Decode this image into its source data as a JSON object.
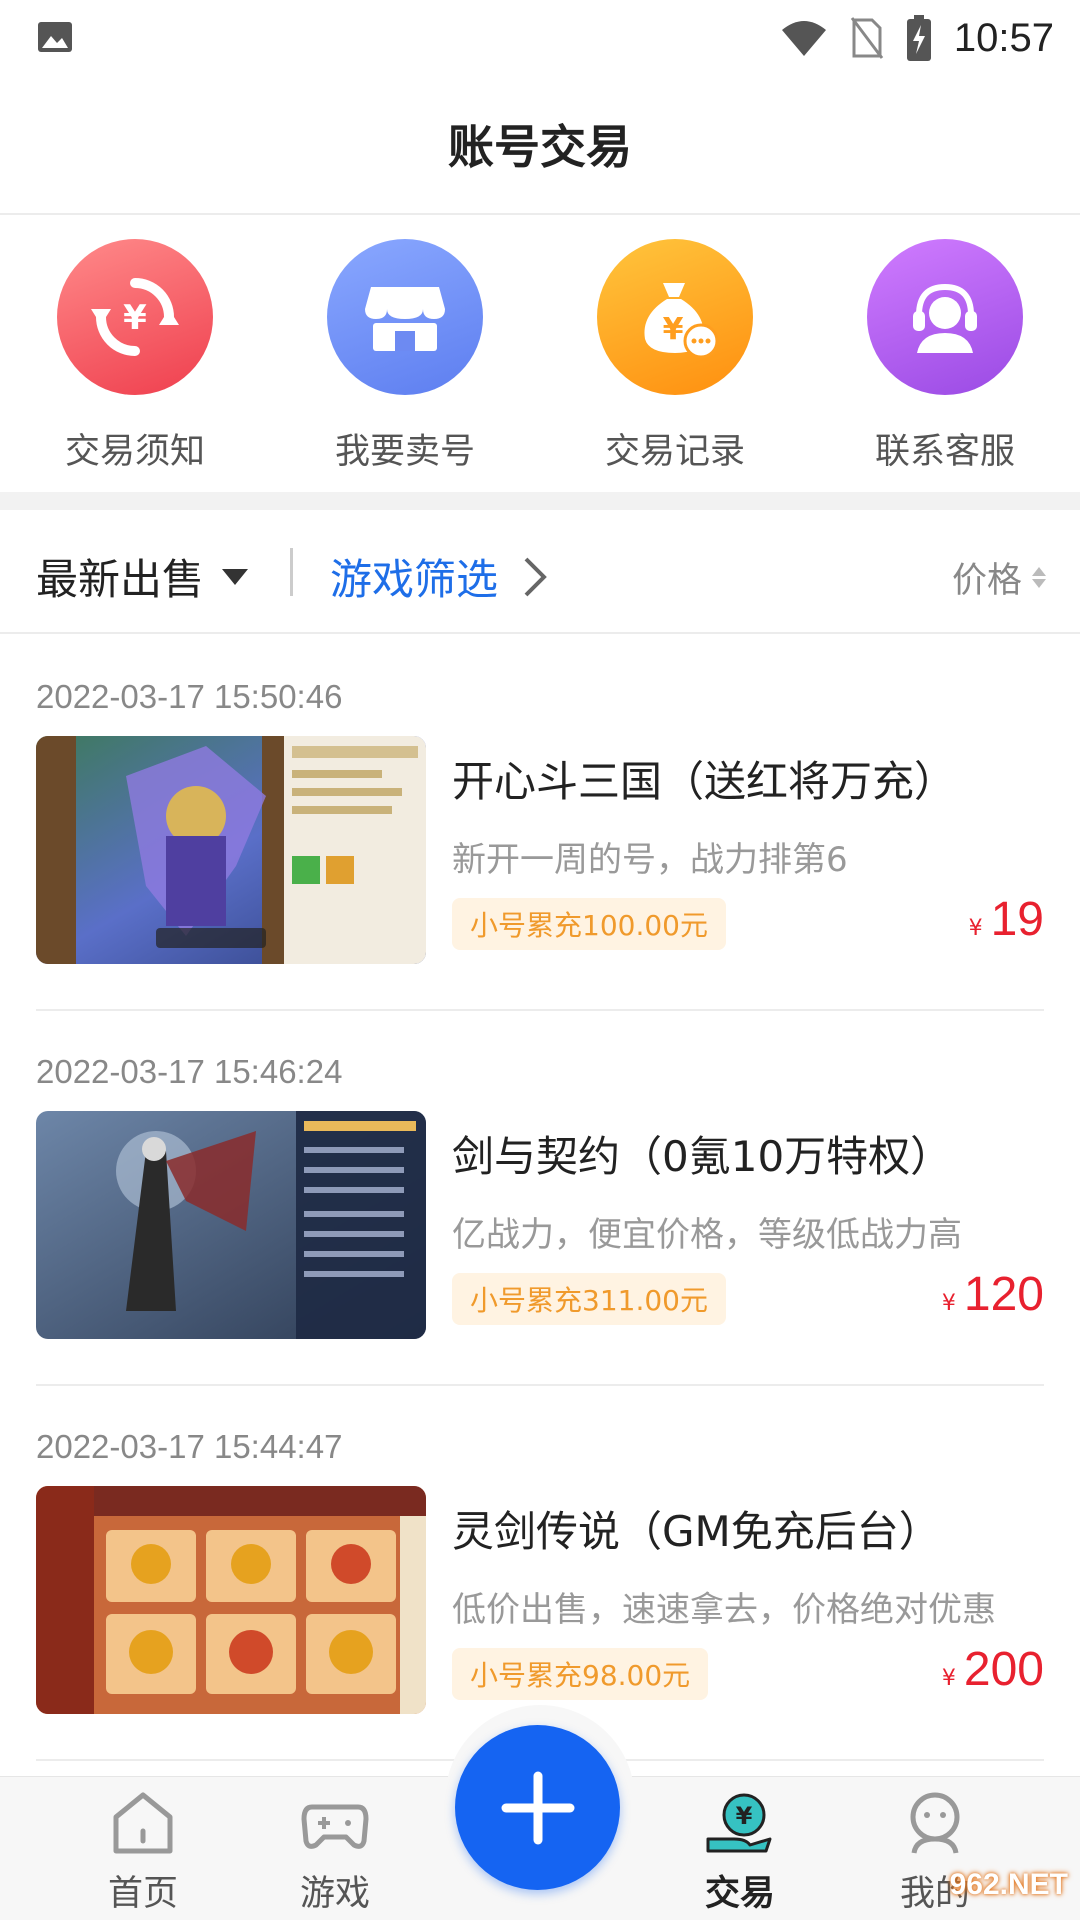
{
  "status_bar": {
    "time": "10:57"
  },
  "header": {
    "title": "账号交易"
  },
  "quick_actions": [
    {
      "label": "交易须知",
      "icon": "yuan-exchange-icon",
      "color": "#ef3f4e"
    },
    {
      "label": "我要卖号",
      "icon": "storefront-icon",
      "color": "#5d7ef0"
    },
    {
      "label": "交易记录",
      "icon": "money-bag-icon",
      "color": "#ff8f0f"
    },
    {
      "label": "联系客服",
      "icon": "customer-service-icon",
      "color": "#9a4ae4"
    }
  ],
  "filters": {
    "sort_label": "最新出售",
    "game_filter_label": "游戏筛选",
    "price_label": "价格"
  },
  "listings": [
    {
      "date": "2022-03-17 15:50:46",
      "title": "开心斗三国（送红将万充）",
      "desc": "新开一周的号，战力排第6",
      "tag": "小号累充100.00元",
      "currency": "¥",
      "price": "19"
    },
    {
      "date": "2022-03-17 15:46:24",
      "title": "剑与契约（0氪10万特权）",
      "desc": "亿战力，便宜价格，等级低战力高",
      "tag": "小号累充311.00元",
      "currency": "¥",
      "price": "120"
    },
    {
      "date": "2022-03-17 15:44:47",
      "title": "灵剑传说（GM免充后台）",
      "desc": "低价出售，速速拿去，价格绝对优惠",
      "tag": "小号累充98.00元",
      "currency": "¥",
      "price": "200"
    }
  ],
  "bottom_nav": [
    {
      "label": "首页",
      "icon": "home-icon"
    },
    {
      "label": "游戏",
      "icon": "gamepad-icon"
    },
    {
      "label": "交易",
      "icon": "trade-yuan-icon",
      "active": true
    },
    {
      "label": "我的",
      "icon": "profile-icon"
    }
  ],
  "watermark": "962.NET",
  "colors": {
    "accent_blue": "#1564f2",
    "price_red": "#e8212f",
    "tag_orange": "#f09a2c"
  }
}
